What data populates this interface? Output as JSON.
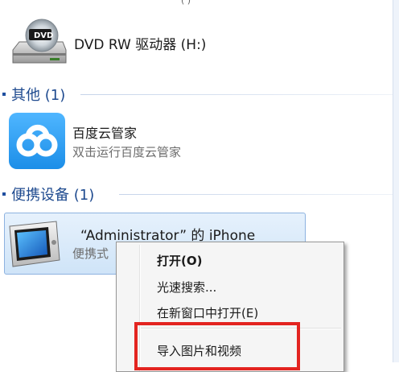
{
  "top_partial_text": "( )",
  "drive": {
    "label": "DVD RW 驱动器 (H:)",
    "disc_text": "DVD"
  },
  "groups": [
    {
      "title": "其他 (1)"
    },
    {
      "title": "便携设备 (1)"
    }
  ],
  "baidu": {
    "name": "百度云管家",
    "description": "双击运行百度云管家"
  },
  "iphone": {
    "name": "“Administrator” 的 iPhone",
    "type_text": "便携式"
  },
  "context_menu": {
    "items": [
      {
        "label": "打开(O)"
      },
      {
        "label": "光速搜索..."
      },
      {
        "label": "在新窗口中打开(E)"
      },
      {
        "label": "导入图片和视频"
      }
    ]
  },
  "colors": {
    "group_title": "#1e4a8f",
    "selection_border": "#8db2e0",
    "highlight_box": "#e32420",
    "baidu_blue": "#1c8ee8"
  }
}
